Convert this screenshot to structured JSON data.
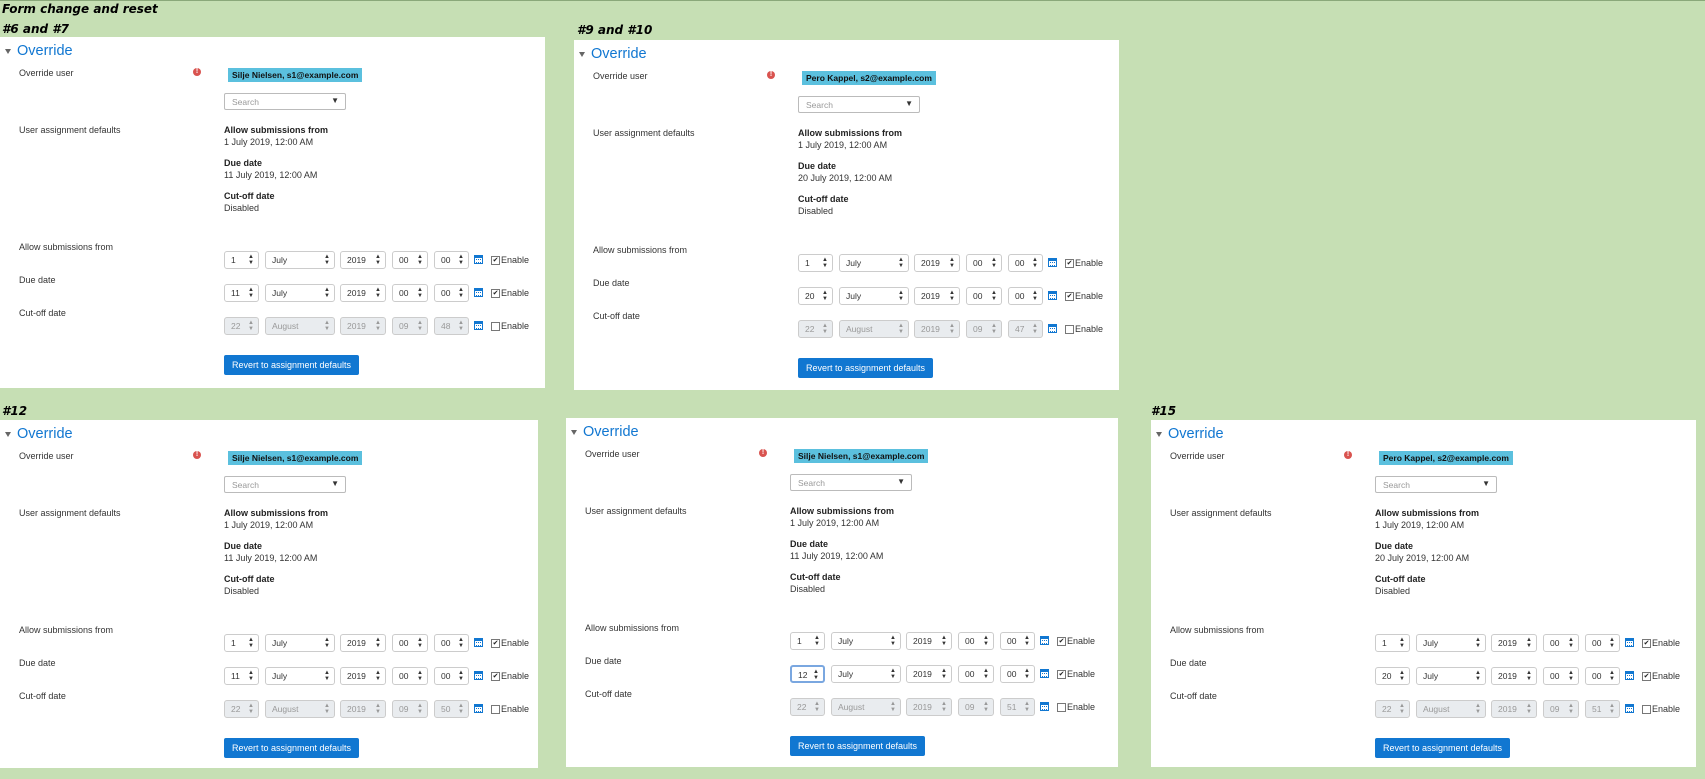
{
  "page_title": "Form change and reset",
  "labels": {
    "override": "Override",
    "override_user": "Override user",
    "search_placeholder": "Search",
    "dropdown_arrow": "▼",
    "user_assignment_defaults": "User assignment defaults",
    "allow_submissions_from": "Allow submissions from",
    "due_date": "Due date",
    "cutoff_date": "Cut-off date",
    "enable": "Enable",
    "revert": "Revert to assignment defaults",
    "required_mark": "!"
  },
  "icons": {
    "required": "exclamation-circle-icon",
    "calendar": "calendar-icon",
    "collapse": "chevron-down-icon"
  },
  "colors": {
    "accent": "#1177d1",
    "chip": "#5bc0de",
    "background": "#c6dfb4",
    "required": "#d9534f"
  },
  "panels": [
    {
      "header": "#6 and #7",
      "user_chip": "Silje Nielsen, s1@example.com",
      "defaults": {
        "allow_from": "1 July 2019, 12:00 AM",
        "due": "11 July 2019, 12:00 AM",
        "cutoff": "Disabled"
      },
      "rows": [
        {
          "day": "1",
          "month": "July",
          "year": "2019",
          "hour": "00",
          "minute": "00",
          "enabled": true
        },
        {
          "day": "11",
          "month": "July",
          "year": "2019",
          "hour": "00",
          "minute": "00",
          "enabled": true
        },
        {
          "day": "22",
          "month": "August",
          "year": "2019",
          "hour": "09",
          "minute": "48",
          "enabled": false
        }
      ]
    },
    {
      "header": "#9 and #10",
      "user_chip": "Pero Kappel, s2@example.com",
      "defaults": {
        "allow_from": "1 July 2019, 12:00 AM",
        "due": "20 July 2019, 12:00 AM",
        "cutoff": "Disabled"
      },
      "rows": [
        {
          "day": "1",
          "month": "July",
          "year": "2019",
          "hour": "00",
          "minute": "00",
          "enabled": true
        },
        {
          "day": "20",
          "month": "July",
          "year": "2019",
          "hour": "00",
          "minute": "00",
          "enabled": true
        },
        {
          "day": "22",
          "month": "August",
          "year": "2019",
          "hour": "09",
          "minute": "47",
          "enabled": false
        }
      ]
    },
    {
      "header": "#12",
      "user_chip": "Silje Nielsen, s1@example.com",
      "defaults": {
        "allow_from": "1 July 2019, 12:00 AM",
        "due": "11 July 2019, 12:00 AM",
        "cutoff": "Disabled"
      },
      "rows": [
        {
          "day": "1",
          "month": "July",
          "year": "2019",
          "hour": "00",
          "minute": "00",
          "enabled": true
        },
        {
          "day": "11",
          "month": "July",
          "year": "2019",
          "hour": "00",
          "minute": "00",
          "enabled": true
        },
        {
          "day": "22",
          "month": "August",
          "year": "2019",
          "hour": "09",
          "minute": "50",
          "enabled": false
        }
      ]
    },
    {
      "header": "",
      "user_chip": "Silje Nielsen, s1@example.com",
      "defaults": {
        "allow_from": "1 July 2019, 12:00 AM",
        "due": "11 July 2019, 12:00 AM",
        "cutoff": "Disabled"
      },
      "rows": [
        {
          "day": "1",
          "month": "July",
          "year": "2019",
          "hour": "00",
          "minute": "00",
          "enabled": true
        },
        {
          "day": "12",
          "month": "July",
          "year": "2019",
          "hour": "00",
          "minute": "00",
          "enabled": true,
          "focused_day": true
        },
        {
          "day": "22",
          "month": "August",
          "year": "2019",
          "hour": "09",
          "minute": "51",
          "enabled": false
        }
      ]
    },
    {
      "header": "#15",
      "user_chip": "Pero Kappel, s2@example.com",
      "defaults": {
        "allow_from": "1 July 2019, 12:00 AM",
        "due": "20 July 2019, 12:00 AM",
        "cutoff": "Disabled"
      },
      "rows": [
        {
          "day": "1",
          "month": "July",
          "year": "2019",
          "hour": "00",
          "minute": "00",
          "enabled": true
        },
        {
          "day": "20",
          "month": "July",
          "year": "2019",
          "hour": "00",
          "minute": "00",
          "enabled": true
        },
        {
          "day": "22",
          "month": "August",
          "year": "2019",
          "hour": "09",
          "minute": "51",
          "enabled": false
        }
      ]
    }
  ]
}
